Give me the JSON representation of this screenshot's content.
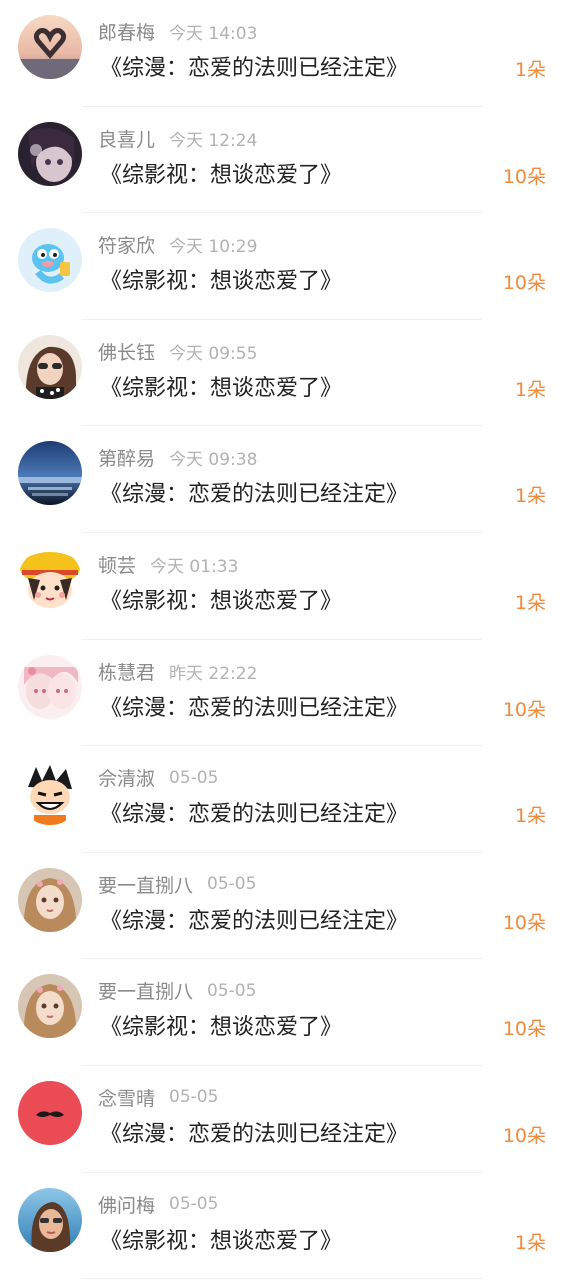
{
  "gift_list": [
    {
      "user": "郎春梅",
      "time": "今天 14:03",
      "title": "《综漫：恋爱的法则已经注定》",
      "count": "1朵",
      "avatar": "hands-heart-sunset-avatar"
    },
    {
      "user": "良喜儿",
      "time": "今天 12:24",
      "title": "《综影视：想谈恋爱了》",
      "count": "10朵",
      "avatar": "dark-anime-girl-avatar"
    },
    {
      "user": "符家欣",
      "time": "今天 10:29",
      "title": "《综影视：想谈恋爱了》",
      "count": "10朵",
      "avatar": "blue-cartoon-creature-avatar"
    },
    {
      "user": "佛长钰",
      "time": "今天 09:55",
      "title": "《综影视：想谈恋爱了》",
      "count": "1朵",
      "avatar": "girl-sunglasses-photo-avatar"
    },
    {
      "user": "第醉易",
      "time": "今天 09:38",
      "title": "《综漫：恋爱的法则已经注定》",
      "count": "1朵",
      "avatar": "night-seaside-photo-avatar"
    },
    {
      "user": "顿芸",
      "time": "今天 01:33",
      "title": "《综影视：想谈恋爱了》",
      "count": "1朵",
      "avatar": "cartoon-girl-yellow-hat-avatar"
    },
    {
      "user": "栋慧君",
      "time": "昨天 22:22",
      "title": "《综漫：恋爱的法则已经注定》",
      "count": "10朵",
      "avatar": "pink-anime-girls-avatar"
    },
    {
      "user": "佘清淑",
      "time": "05-05",
      "title": "《综漫：恋爱的法则已经注定》",
      "count": "1朵",
      "avatar": "cartoon-boy-grin-avatar"
    },
    {
      "user": "要一直捌八",
      "time": "05-05",
      "title": "《综漫：恋爱的法则已经注定》",
      "count": "10朵",
      "avatar": "illustrated-girl-avatar"
    },
    {
      "user": "要一直捌八",
      "time": "05-05",
      "title": "《综影视：想谈恋爱了》",
      "count": "10朵",
      "avatar": "illustrated-girl-avatar"
    },
    {
      "user": "念雪晴",
      "time": "05-05",
      "title": "《综漫：恋爱的法则已经注定》",
      "count": "10朵",
      "avatar": "red-mustache-avatar"
    },
    {
      "user": "佛问梅",
      "time": "05-05",
      "title": "《综影视：想谈恋爱了》",
      "count": "1朵",
      "avatar": "girl-beach-photo-avatar"
    }
  ],
  "colors": {
    "count": "#f08a3c",
    "username": "#8a8a8a",
    "time": "#b2b2b2",
    "title": "#222222",
    "divider": "#f0f0f0"
  }
}
